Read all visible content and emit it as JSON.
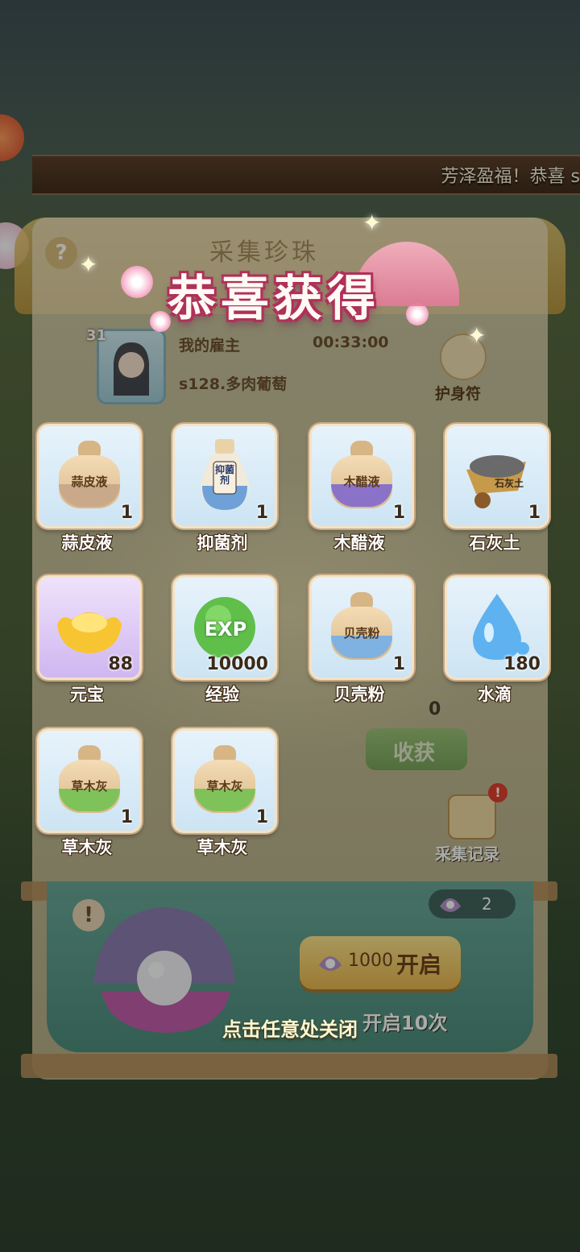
{
  "banner": {
    "text": "芳泽盈福！恭喜 s"
  },
  "panel": {
    "title": "采集珍珠"
  },
  "employer": {
    "label": "我的雇主",
    "timer": "00:33:00",
    "name": "s128.多肉葡萄",
    "level": "31"
  },
  "amulet": {
    "label": "护身符"
  },
  "popup": {
    "title": "恭喜获得",
    "close_hint": "点击任意处关闭"
  },
  "items": [
    {
      "name": "蒜皮液",
      "qty": "1",
      "icon": "sack-icon",
      "tag": "蒜皮液",
      "band": "#c9a98a"
    },
    {
      "name": "抑菌剂",
      "qty": "1",
      "icon": "bottle-icon",
      "tag": "抑菌剂",
      "band": "#6fa0d8"
    },
    {
      "name": "木醋液",
      "qty": "1",
      "icon": "sack-icon",
      "tag": "木醋液",
      "band": "#8a72c8"
    },
    {
      "name": "石灰土",
      "qty": "1",
      "icon": "wheelbarrow-icon",
      "tag": "石灰土",
      "band": "#c9a95a"
    },
    {
      "name": "元宝",
      "qty": "88",
      "icon": "gold-ingot-icon",
      "tag": "",
      "band": "#f5c842"
    },
    {
      "name": "经验",
      "qty": "10000",
      "icon": "exp-orb-icon",
      "tag": "EXP",
      "band": "#5fbf4a"
    },
    {
      "name": "贝壳粉",
      "qty": "1",
      "icon": "sack-icon",
      "tag": "贝壳粉",
      "band": "#7fb2e0"
    },
    {
      "name": "水滴",
      "qty": "180",
      "icon": "water-drop-icon",
      "tag": "",
      "band": "#5fb2f0"
    },
    {
      "name": "草木灰",
      "qty": "1",
      "icon": "sack-icon",
      "tag": "草木灰",
      "band": "#7fc25a"
    },
    {
      "name": "草木灰",
      "qty": "1",
      "icon": "sack-icon",
      "tag": "草木灰",
      "band": "#7fc25a"
    }
  ],
  "harvest": {
    "label": "收获",
    "count": "0"
  },
  "record": {
    "label": "采集记录"
  },
  "pearls": {
    "count": "2"
  },
  "open": {
    "cost": "1000",
    "label": "开启",
    "open10_label": "开启10次"
  },
  "colors": {
    "title_outline": "#b0305a",
    "accent": "#e9b34a"
  }
}
